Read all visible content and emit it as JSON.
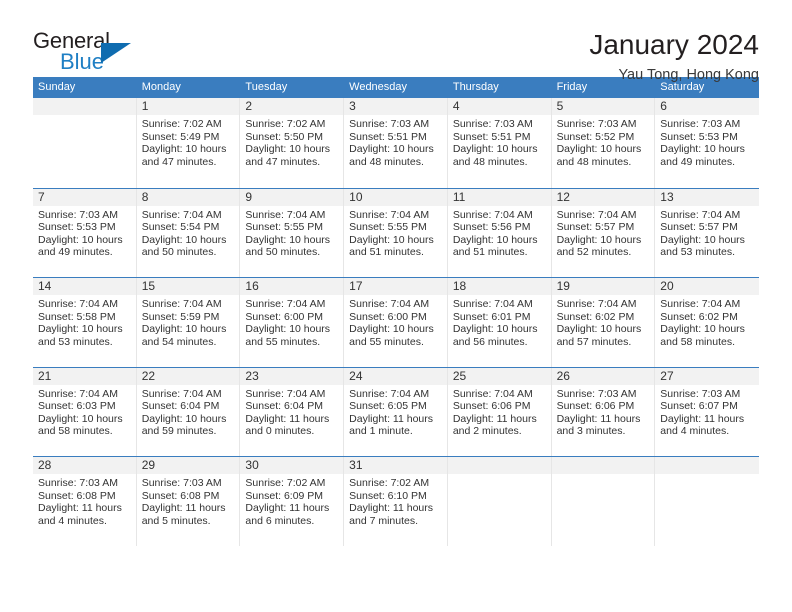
{
  "brand": {
    "name_part1": "General",
    "name_part2": "Blue",
    "accent_color": "#1f7fc4",
    "triangle_color": "#0f6cb0"
  },
  "header": {
    "title": "January 2024",
    "subtitle": "Yau Tong, Hong Kong",
    "header_bg": "#3a7dbf"
  },
  "weekdays": [
    "Sunday",
    "Monday",
    "Tuesday",
    "Wednesday",
    "Thursday",
    "Friday",
    "Saturday"
  ],
  "weeks": [
    [
      {
        "empty": true
      },
      {
        "day": "1",
        "sunrise": "Sunrise: 7:02 AM",
        "sunset": "Sunset: 5:49 PM",
        "daylight1": "Daylight: 10 hours",
        "daylight2": "and 47 minutes."
      },
      {
        "day": "2",
        "sunrise": "Sunrise: 7:02 AM",
        "sunset": "Sunset: 5:50 PM",
        "daylight1": "Daylight: 10 hours",
        "daylight2": "and 47 minutes."
      },
      {
        "day": "3",
        "sunrise": "Sunrise: 7:03 AM",
        "sunset": "Sunset: 5:51 PM",
        "daylight1": "Daylight: 10 hours",
        "daylight2": "and 48 minutes."
      },
      {
        "day": "4",
        "sunrise": "Sunrise: 7:03 AM",
        "sunset": "Sunset: 5:51 PM",
        "daylight1": "Daylight: 10 hours",
        "daylight2": "and 48 minutes."
      },
      {
        "day": "5",
        "sunrise": "Sunrise: 7:03 AM",
        "sunset": "Sunset: 5:52 PM",
        "daylight1": "Daylight: 10 hours",
        "daylight2": "and 48 minutes."
      },
      {
        "day": "6",
        "sunrise": "Sunrise: 7:03 AM",
        "sunset": "Sunset: 5:53 PM",
        "daylight1": "Daylight: 10 hours",
        "daylight2": "and 49 minutes."
      }
    ],
    [
      {
        "day": "7",
        "sunrise": "Sunrise: 7:03 AM",
        "sunset": "Sunset: 5:53 PM",
        "daylight1": "Daylight: 10 hours",
        "daylight2": "and 49 minutes."
      },
      {
        "day": "8",
        "sunrise": "Sunrise: 7:04 AM",
        "sunset": "Sunset: 5:54 PM",
        "daylight1": "Daylight: 10 hours",
        "daylight2": "and 50 minutes."
      },
      {
        "day": "9",
        "sunrise": "Sunrise: 7:04 AM",
        "sunset": "Sunset: 5:55 PM",
        "daylight1": "Daylight: 10 hours",
        "daylight2": "and 50 minutes."
      },
      {
        "day": "10",
        "sunrise": "Sunrise: 7:04 AM",
        "sunset": "Sunset: 5:55 PM",
        "daylight1": "Daylight: 10 hours",
        "daylight2": "and 51 minutes."
      },
      {
        "day": "11",
        "sunrise": "Sunrise: 7:04 AM",
        "sunset": "Sunset: 5:56 PM",
        "daylight1": "Daylight: 10 hours",
        "daylight2": "and 51 minutes."
      },
      {
        "day": "12",
        "sunrise": "Sunrise: 7:04 AM",
        "sunset": "Sunset: 5:57 PM",
        "daylight1": "Daylight: 10 hours",
        "daylight2": "and 52 minutes."
      },
      {
        "day": "13",
        "sunrise": "Sunrise: 7:04 AM",
        "sunset": "Sunset: 5:57 PM",
        "daylight1": "Daylight: 10 hours",
        "daylight2": "and 53 minutes."
      }
    ],
    [
      {
        "day": "14",
        "sunrise": "Sunrise: 7:04 AM",
        "sunset": "Sunset: 5:58 PM",
        "daylight1": "Daylight: 10 hours",
        "daylight2": "and 53 minutes."
      },
      {
        "day": "15",
        "sunrise": "Sunrise: 7:04 AM",
        "sunset": "Sunset: 5:59 PM",
        "daylight1": "Daylight: 10 hours",
        "daylight2": "and 54 minutes."
      },
      {
        "day": "16",
        "sunrise": "Sunrise: 7:04 AM",
        "sunset": "Sunset: 6:00 PM",
        "daylight1": "Daylight: 10 hours",
        "daylight2": "and 55 minutes."
      },
      {
        "day": "17",
        "sunrise": "Sunrise: 7:04 AM",
        "sunset": "Sunset: 6:00 PM",
        "daylight1": "Daylight: 10 hours",
        "daylight2": "and 55 minutes."
      },
      {
        "day": "18",
        "sunrise": "Sunrise: 7:04 AM",
        "sunset": "Sunset: 6:01 PM",
        "daylight1": "Daylight: 10 hours",
        "daylight2": "and 56 minutes."
      },
      {
        "day": "19",
        "sunrise": "Sunrise: 7:04 AM",
        "sunset": "Sunset: 6:02 PM",
        "daylight1": "Daylight: 10 hours",
        "daylight2": "and 57 minutes."
      },
      {
        "day": "20",
        "sunrise": "Sunrise: 7:04 AM",
        "sunset": "Sunset: 6:02 PM",
        "daylight1": "Daylight: 10 hours",
        "daylight2": "and 58 minutes."
      }
    ],
    [
      {
        "day": "21",
        "sunrise": "Sunrise: 7:04 AM",
        "sunset": "Sunset: 6:03 PM",
        "daylight1": "Daylight: 10 hours",
        "daylight2": "and 58 minutes."
      },
      {
        "day": "22",
        "sunrise": "Sunrise: 7:04 AM",
        "sunset": "Sunset: 6:04 PM",
        "daylight1": "Daylight: 10 hours",
        "daylight2": "and 59 minutes."
      },
      {
        "day": "23",
        "sunrise": "Sunrise: 7:04 AM",
        "sunset": "Sunset: 6:04 PM",
        "daylight1": "Daylight: 11 hours",
        "daylight2": "and 0 minutes."
      },
      {
        "day": "24",
        "sunrise": "Sunrise: 7:04 AM",
        "sunset": "Sunset: 6:05 PM",
        "daylight1": "Daylight: 11 hours",
        "daylight2": "and 1 minute."
      },
      {
        "day": "25",
        "sunrise": "Sunrise: 7:04 AM",
        "sunset": "Sunset: 6:06 PM",
        "daylight1": "Daylight: 11 hours",
        "daylight2": "and 2 minutes."
      },
      {
        "day": "26",
        "sunrise": "Sunrise: 7:03 AM",
        "sunset": "Sunset: 6:06 PM",
        "daylight1": "Daylight: 11 hours",
        "daylight2": "and 3 minutes."
      },
      {
        "day": "27",
        "sunrise": "Sunrise: 7:03 AM",
        "sunset": "Sunset: 6:07 PM",
        "daylight1": "Daylight: 11 hours",
        "daylight2": "and 4 minutes."
      }
    ],
    [
      {
        "day": "28",
        "sunrise": "Sunrise: 7:03 AM",
        "sunset": "Sunset: 6:08 PM",
        "daylight1": "Daylight: 11 hours",
        "daylight2": "and 4 minutes."
      },
      {
        "day": "29",
        "sunrise": "Sunrise: 7:03 AM",
        "sunset": "Sunset: 6:08 PM",
        "daylight1": "Daylight: 11 hours",
        "daylight2": "and 5 minutes."
      },
      {
        "day": "30",
        "sunrise": "Sunrise: 7:02 AM",
        "sunset": "Sunset: 6:09 PM",
        "daylight1": "Daylight: 11 hours",
        "daylight2": "and 6 minutes."
      },
      {
        "day": "31",
        "sunrise": "Sunrise: 7:02 AM",
        "sunset": "Sunset: 6:10 PM",
        "daylight1": "Daylight: 11 hours",
        "daylight2": "and 7 minutes."
      },
      {
        "empty": true
      },
      {
        "empty": true
      },
      {
        "empty": true
      }
    ]
  ]
}
